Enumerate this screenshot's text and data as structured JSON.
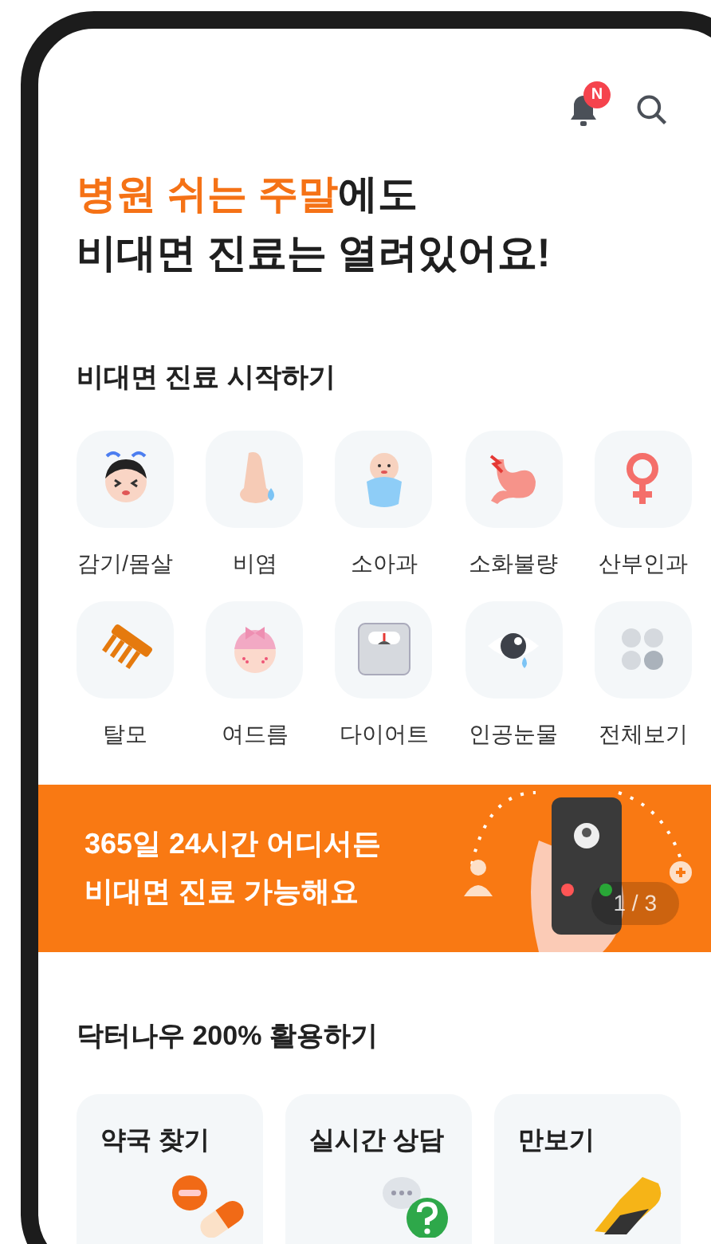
{
  "header": {
    "badge": "N"
  },
  "headline": {
    "highlight": "병원 쉬는 주말",
    "rest": "에도",
    "line2": "비대면 진료는 열려있어요!"
  },
  "start_section": {
    "title": "비대면 진료 시작하기",
    "categories": [
      {
        "label": "감기/몸살",
        "kind": "cold"
      },
      {
        "label": "비염",
        "kind": "nose"
      },
      {
        "label": "소아과",
        "kind": "baby"
      },
      {
        "label": "소화불량",
        "kind": "stomach"
      },
      {
        "label": "산부인과",
        "kind": "female"
      },
      {
        "label": "탈모",
        "kind": "comb"
      },
      {
        "label": "여드름",
        "kind": "acne"
      },
      {
        "label": "다이어트",
        "kind": "scale"
      },
      {
        "label": "인공눈물",
        "kind": "eye"
      },
      {
        "label": "전체보기",
        "kind": "all"
      }
    ]
  },
  "banner": {
    "line1": "365일 24시간 어디서든",
    "line2": "비대면 진료 가능해요",
    "page": "1 / 3"
  },
  "use_section": {
    "title": "닥터나우 200% 활용하기",
    "cards": [
      {
        "label": "약국 찾기",
        "kind": "pill"
      },
      {
        "label": "실시간 상담",
        "kind": "chat"
      },
      {
        "label": "만보기",
        "kind": "shoe"
      }
    ]
  }
}
